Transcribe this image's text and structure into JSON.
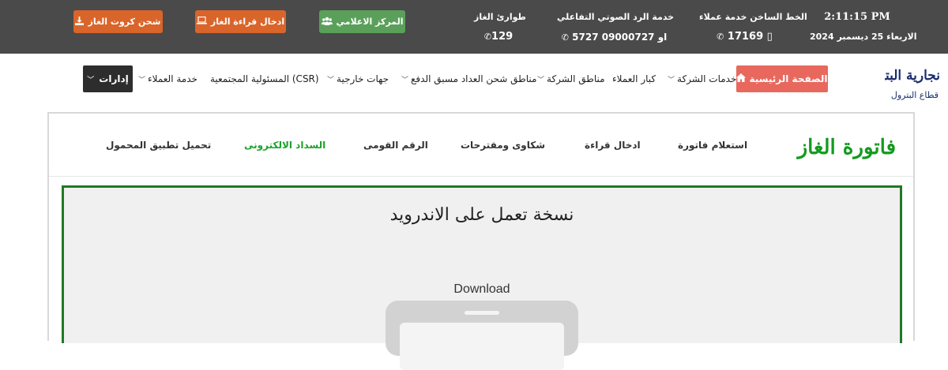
{
  "topbar": {
    "buttons": [
      {
        "label": "شحن كروت الغاز",
        "icon": "download-icon"
      },
      {
        "label": "ادخال قراءة الغاز",
        "icon": "laptop-icon"
      },
      {
        "label": "المركز الاعلامي",
        "icon": "users-icon"
      }
    ],
    "emergency": {
      "label": "طوارئ الغاز",
      "value": "129"
    },
    "ivr": {
      "label": "خدمة الرد الصوتي التفاعلي",
      "value": "5727 او 09000727"
    },
    "hotline": {
      "label": "الخط الساخن خدمة عملاء",
      "value": "17169 ▯"
    },
    "clock": {
      "time": "2:11:15 PM",
      "date": "الاربعاء 25 ديسمبر 2024"
    },
    "colors": {
      "bar": "#4a4a4a",
      "orange": "#d9652b",
      "green": "#5aa05a"
    }
  },
  "nav": {
    "logo": {
      "line1": "نجارية البترولية",
      "line2": "قطاع البترول"
    },
    "home": "الصفحة الرئيسية",
    "items": [
      {
        "label": "خدمات الشركة"
      },
      {
        "label": "كبار العملاء"
      },
      {
        "label": "مناطق الشركة"
      },
      {
        "label": "مناطق شحن العداد مسبق الدفع"
      },
      {
        "label": "جهات خارجية"
      },
      {
        "label": "المسئولية المجتمعية (CSR)"
      },
      {
        "label": "خدمة العملاء"
      },
      {
        "label": "إدارات"
      }
    ],
    "colors": {
      "home": "#e8685e",
      "dark": "#2d2d2d"
    }
  },
  "page": {
    "title": "فاتورة الغاز",
    "subnav": [
      {
        "label": "استعلام فاتورة"
      },
      {
        "label": "ادخال قراءة"
      },
      {
        "label": "شكاوى ومقترحات"
      },
      {
        "label": "الرقم القومى"
      },
      {
        "label": "السداد الالكترونى"
      },
      {
        "label": "تحميل تطبيق المحمول"
      }
    ],
    "box_title": "نسخة تعمل على الاندرويد",
    "download_label": "Download",
    "colors": {
      "title": "#129a1e",
      "border": "#1f7a25"
    }
  }
}
